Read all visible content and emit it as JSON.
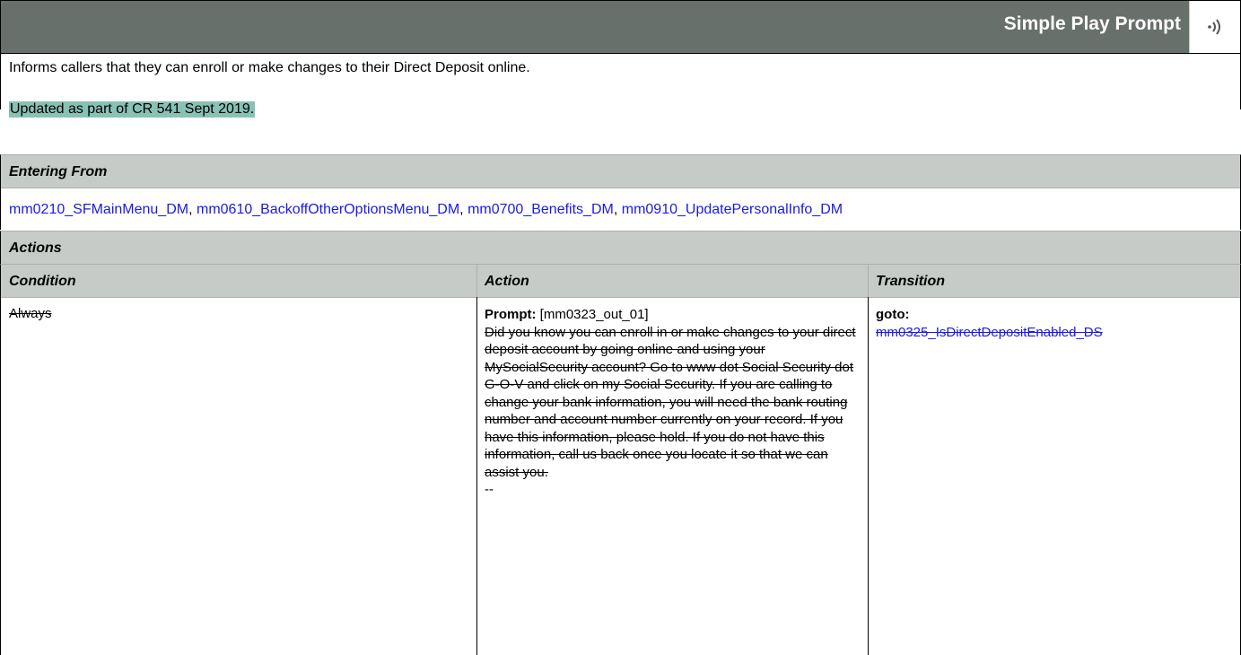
{
  "header": {
    "title": "Simple Play Prompt",
    "icon": "sound-icon"
  },
  "description": "Informs callers that they can enroll or make changes to their Direct Deposit online.",
  "updated_note": "Updated as part of CR 541 Sept 2019.",
  "entering_from": {
    "label": "Entering From",
    "links": [
      "mm0210_SFMainMenu_DM",
      "mm0610_BackoffOtherOptionsMenu_DM",
      "mm0700_Benefits_DM",
      "mm0910_UpdatePersonalInfo_DM"
    ],
    "separator": ","
  },
  "actions": {
    "label": "Actions",
    "columns": {
      "condition": "Condition",
      "action": "Action",
      "transition": "Transition"
    },
    "rows": [
      {
        "condition": "Always",
        "prompt_label": "Prompt:",
        "prompt_id": " [mm0323_out_01]",
        "prompt_text": "Did you know you can enroll in or make changes to your direct deposit account by going online and using your MySocialSecurity account? Go to www dot Social Security dot G-O-V and click on my Social Security. If you are calling to change your bank information, you will need the bank routing number and account number currently on your record.  If you have this information, please hold.  If you do not have this information, call us back once you locate it so that we can assist you.",
        "prompt_trailer": "--",
        "goto_label": "goto:",
        "goto_target": "mm0325_IsDirectDepositEnabled_DS"
      }
    ]
  }
}
